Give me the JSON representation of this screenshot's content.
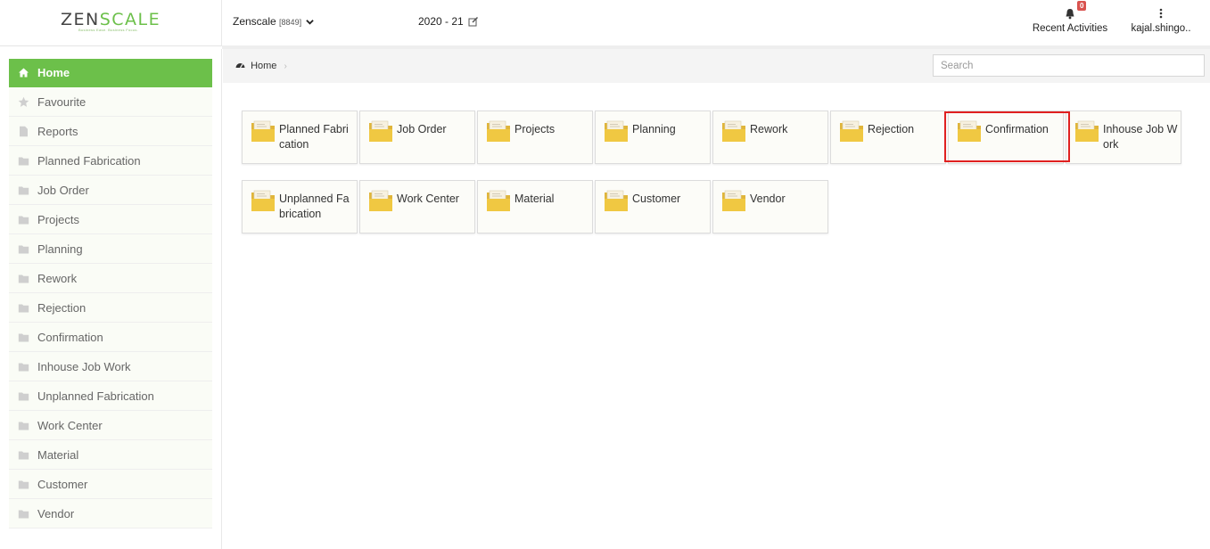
{
  "header": {
    "logo_part1": "ZEN",
    "logo_part2": "SCALE",
    "tagline": "Business Ease. Business Focus.",
    "company_name": "Zenscale",
    "company_code": "[8849]",
    "financial_year": "2020 - 21",
    "notification_count": "0",
    "recent_activities_label": "Recent Activities",
    "user_label": "kajal.shingo.."
  },
  "colors": {
    "accent_green": "#6cc04a",
    "badge_red": "#d9534f",
    "folder_yellow": "#f0c842",
    "highlight_red": "#e02020"
  },
  "sidebar": {
    "items": [
      {
        "label": "Home",
        "icon": "home-icon"
      },
      {
        "label": "Favourite",
        "icon": "star-icon"
      },
      {
        "label": "Reports",
        "icon": "file-icon"
      },
      {
        "label": "Planned Fabrication",
        "icon": "folder-icon"
      },
      {
        "label": "Job Order",
        "icon": "folder-icon"
      },
      {
        "label": "Projects",
        "icon": "folder-icon"
      },
      {
        "label": "Planning",
        "icon": "folder-icon"
      },
      {
        "label": "Rework",
        "icon": "folder-icon"
      },
      {
        "label": "Rejection",
        "icon": "folder-icon"
      },
      {
        "label": "Confirmation",
        "icon": "folder-icon"
      },
      {
        "label": "Inhouse Job Work",
        "icon": "folder-icon"
      },
      {
        "label": "Unplanned Fabrication",
        "icon": "folder-icon"
      },
      {
        "label": "Work Center",
        "icon": "folder-icon"
      },
      {
        "label": "Material",
        "icon": "folder-icon"
      },
      {
        "label": "Customer",
        "icon": "folder-icon"
      },
      {
        "label": "Vendor",
        "icon": "folder-icon"
      }
    ]
  },
  "breadcrumb": {
    "home_label": "Home",
    "separator": "›"
  },
  "search": {
    "placeholder": "Search",
    "value": ""
  },
  "tiles": [
    {
      "label": "Planned Fabrication"
    },
    {
      "label": "Job Order"
    },
    {
      "label": "Projects"
    },
    {
      "label": "Planning"
    },
    {
      "label": "Rework"
    },
    {
      "label": "Rejection"
    },
    {
      "label": "Confirmation"
    },
    {
      "label": "Inhouse Job Work"
    },
    {
      "label": "Unplanned Fabrication"
    },
    {
      "label": "Work Center"
    },
    {
      "label": "Material"
    },
    {
      "label": "Customer"
    },
    {
      "label": "Vendor"
    }
  ]
}
